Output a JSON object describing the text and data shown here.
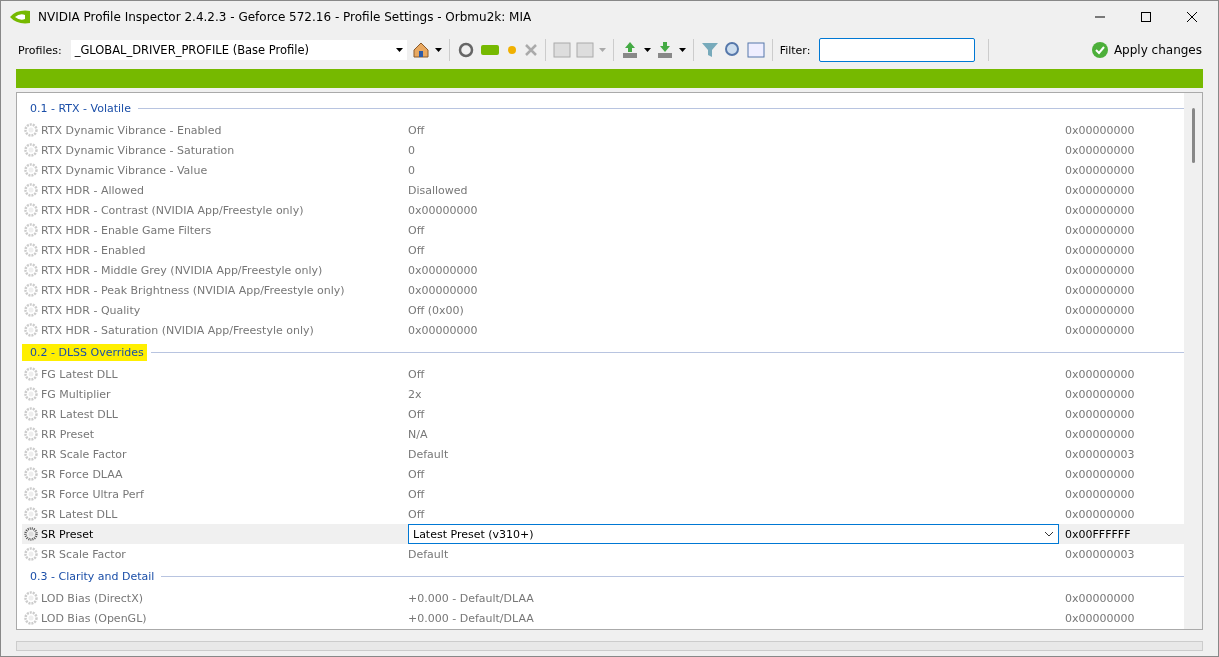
{
  "window": {
    "title": "NVIDIA Profile Inspector 2.4.2.3 - Geforce 572.16 - Profile Settings - Orbmu2k: MIA"
  },
  "toolbar": {
    "profiles_label": "Profiles:",
    "profile": "_GLOBAL_DRIVER_PROFILE (Base Profile)",
    "filter_label": "Filter:",
    "apply": "Apply changes"
  },
  "groups": [
    {
      "title": "0.1 - RTX - Volatile",
      "highlighted": false,
      "rows": [
        {
          "name": "RTX Dynamic Vibrance - Enabled",
          "value": "Off",
          "hex": "0x00000000",
          "selected": false
        },
        {
          "name": "RTX Dynamic Vibrance - Saturation",
          "value": "0",
          "hex": "0x00000000",
          "selected": false
        },
        {
          "name": "RTX Dynamic Vibrance - Value",
          "value": "0",
          "hex": "0x00000000",
          "selected": false
        },
        {
          "name": "RTX HDR - Allowed",
          "value": "Disallowed",
          "hex": "0x00000000",
          "selected": false
        },
        {
          "name": "RTX HDR - Contrast (NVIDIA App/Freestyle only)",
          "value": "0x00000000",
          "hex": "0x00000000",
          "selected": false
        },
        {
          "name": "RTX HDR - Enable Game Filters",
          "value": "Off",
          "hex": "0x00000000",
          "selected": false
        },
        {
          "name": "RTX HDR - Enabled",
          "value": "Off",
          "hex": "0x00000000",
          "selected": false
        },
        {
          "name": "RTX HDR - Middle Grey (NVIDIA App/Freestyle only)",
          "value": "0x00000000",
          "hex": "0x00000000",
          "selected": false
        },
        {
          "name": "RTX HDR - Peak Brightness (NVIDIA App/Freestyle only)",
          "value": "0x00000000",
          "hex": "0x00000000",
          "selected": false
        },
        {
          "name": "RTX HDR - Quality",
          "value": "Off (0x00)",
          "hex": "0x00000000",
          "selected": false
        },
        {
          "name": "RTX HDR - Saturation (NVIDIA App/Freestyle only)",
          "value": "0x00000000",
          "hex": "0x00000000",
          "selected": false
        }
      ]
    },
    {
      "title": "0.2 - DLSS Overrides",
      "highlighted": true,
      "rows": [
        {
          "name": "FG Latest DLL",
          "value": "Off",
          "hex": "0x00000000",
          "selected": false
        },
        {
          "name": "FG Multiplier",
          "value": "2x",
          "hex": "0x00000000",
          "selected": false
        },
        {
          "name": "RR Latest DLL",
          "value": "Off",
          "hex": "0x00000000",
          "selected": false
        },
        {
          "name": "RR Preset",
          "value": "N/A",
          "hex": "0x00000000",
          "selected": false
        },
        {
          "name": "RR Scale Factor",
          "value": "Default",
          "hex": "0x00000003",
          "selected": false
        },
        {
          "name": "SR Force DLAA",
          "value": "Off",
          "hex": "0x00000000",
          "selected": false
        },
        {
          "name": "SR Force Ultra Perf",
          "value": "Off",
          "hex": "0x00000000",
          "selected": false
        },
        {
          "name": "SR Latest DLL",
          "value": "Off",
          "hex": "0x00000000",
          "selected": false
        },
        {
          "name": "SR Preset",
          "value": "Latest Preset (v310+)",
          "hex": "0x00FFFFFF",
          "selected": true
        },
        {
          "name": "SR Scale Factor",
          "value": "Default",
          "hex": "0x00000003",
          "selected": false
        }
      ]
    },
    {
      "title": "0.3 - Clarity and Detail",
      "highlighted": false,
      "rows": [
        {
          "name": "LOD Bias (DirectX)",
          "value": "+0.000 - Default/DLAA",
          "hex": "0x00000000",
          "selected": false
        },
        {
          "name": "LOD Bias (OpenGL)",
          "value": "+0.000 - Default/DLAA",
          "hex": "0x00000000",
          "selected": false
        }
      ]
    }
  ]
}
